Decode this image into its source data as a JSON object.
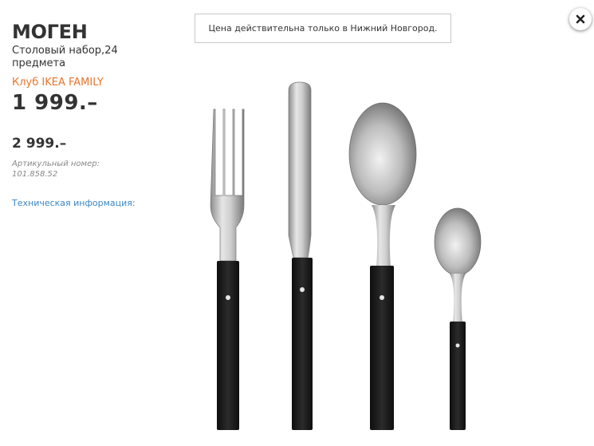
{
  "product": {
    "name": "МОГЕН",
    "description": "Столовый набор,24 предмета",
    "family_label": "Клуб IKEA FAMILY",
    "family_price": "1 999.–",
    "regular_price": "2 999.–",
    "article": "Артикульный номер: 101.858.52",
    "tech_info_link": "Техническая информация:"
  },
  "notice": {
    "text": "Цена действительна только в Нижний Новгород."
  },
  "close_button": {
    "icon": "close-icon"
  },
  "colors": {
    "family_orange": "#e8752c",
    "link_blue": "#3a87c4",
    "handle_black": "#1c1c1c"
  },
  "image": {
    "items": [
      "fork",
      "knife",
      "spoon",
      "teaspoon"
    ]
  }
}
